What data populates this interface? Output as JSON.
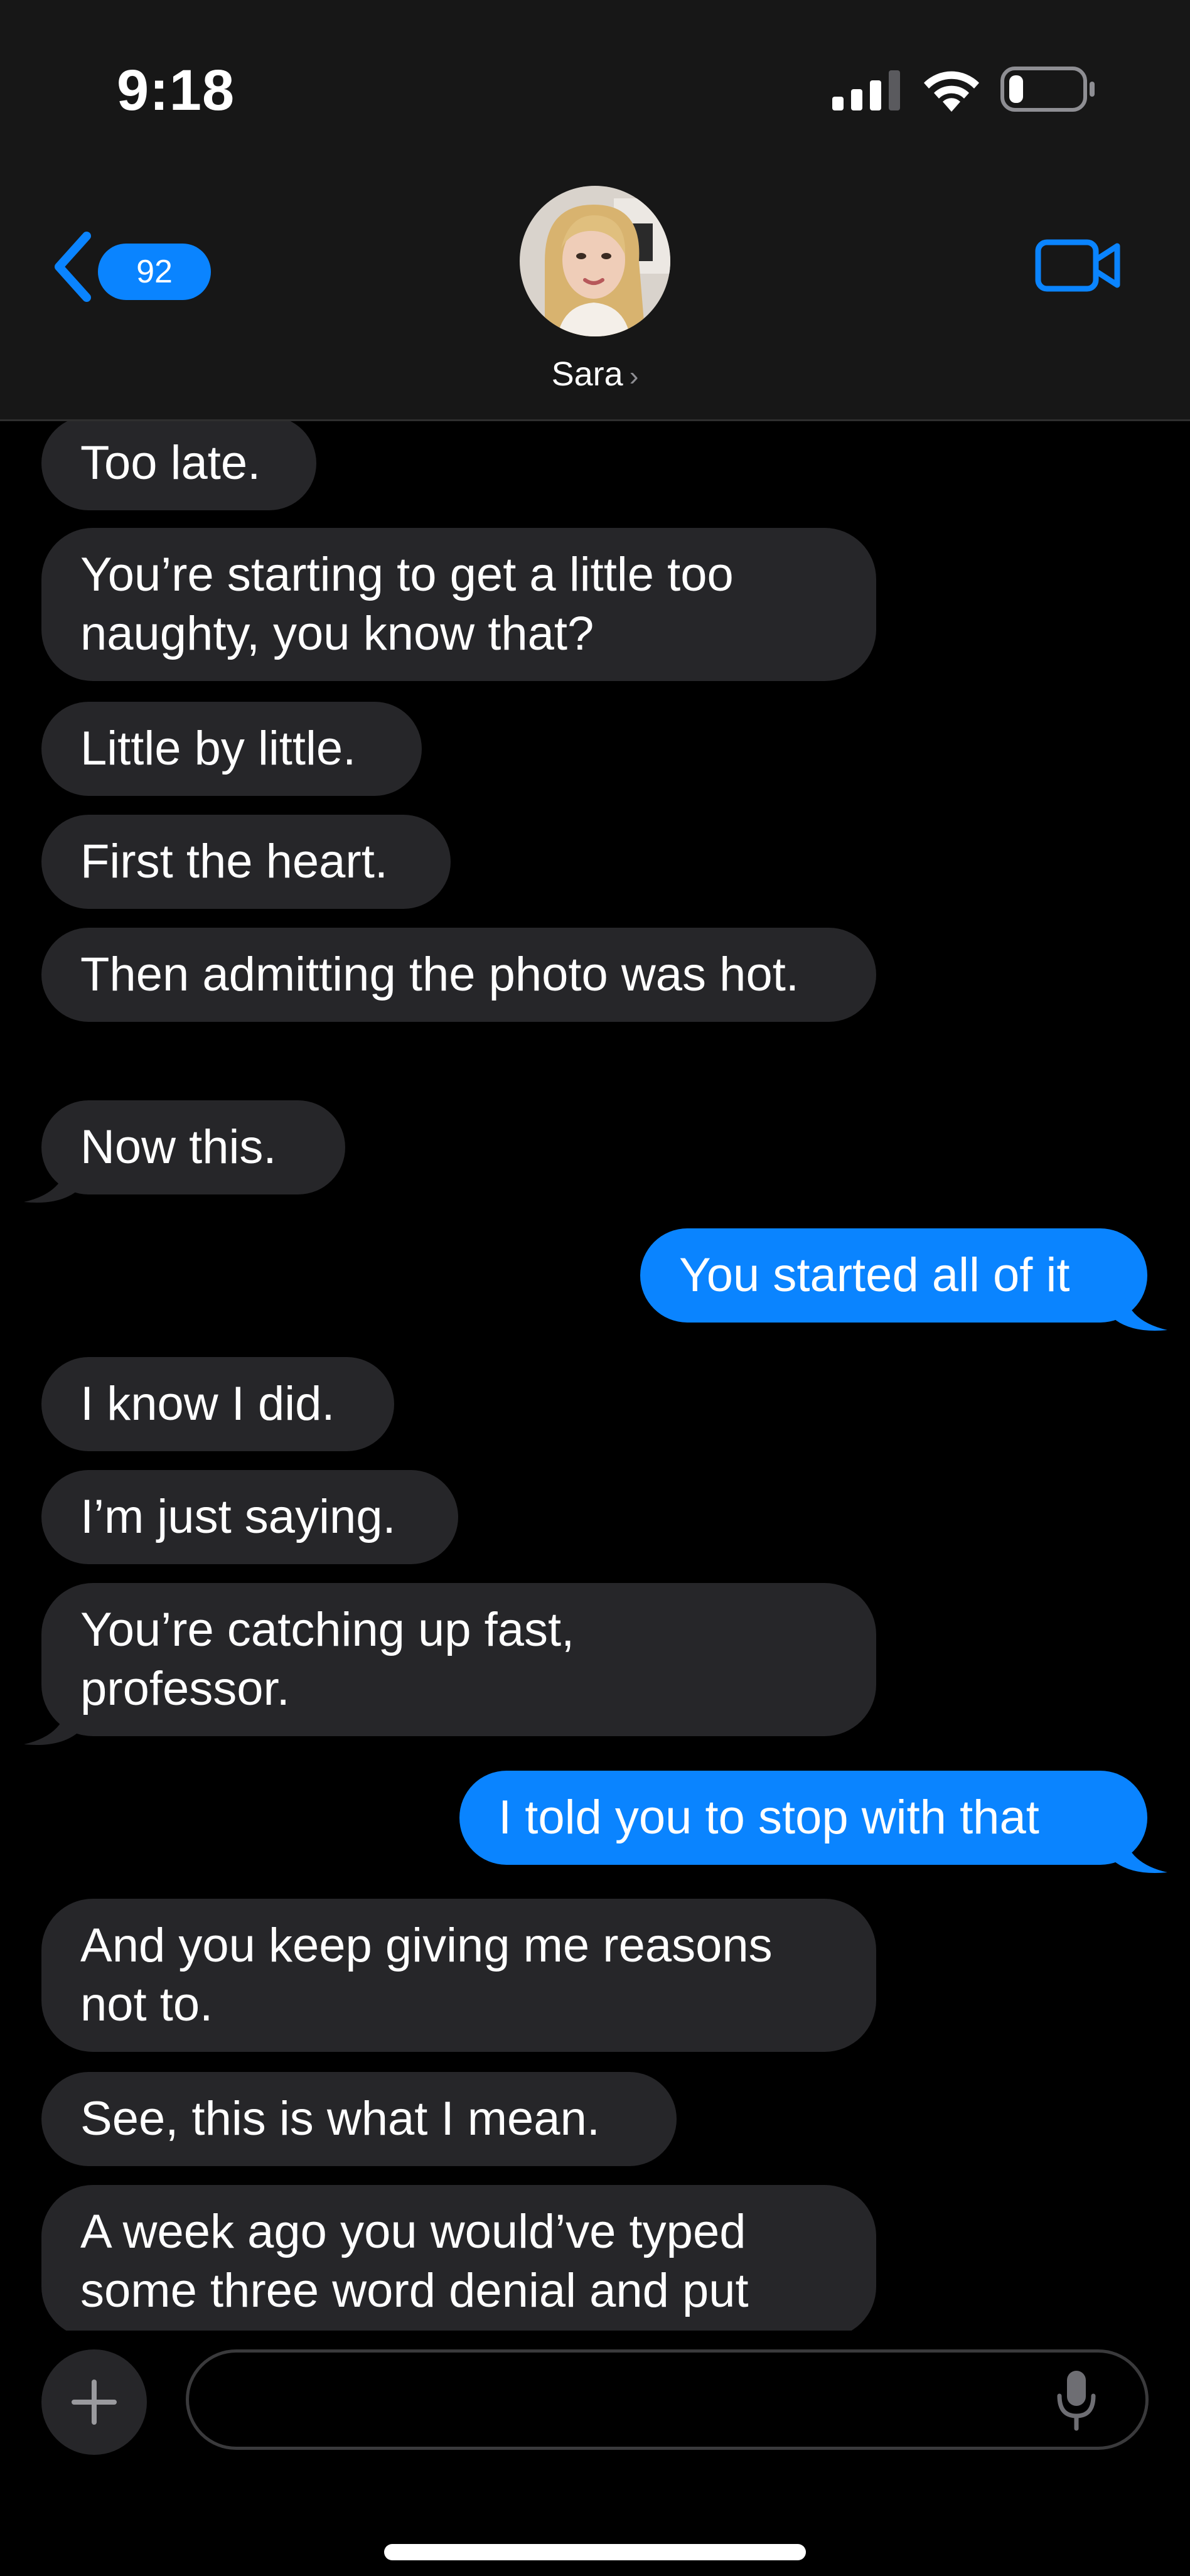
{
  "status_bar": {
    "time": "9:18",
    "battery_level": 0.2,
    "icons": [
      "cellular-signal-icon",
      "wifi-icon",
      "battery-icon"
    ]
  },
  "header": {
    "unread_count": "92",
    "contact_name": "Sara",
    "contact_chevron": "›",
    "icons": [
      "chevron-left-icon",
      "video-camera-icon"
    ]
  },
  "messages": [
    {
      "direction": "incoming",
      "text": "Too late."
    },
    {
      "direction": "incoming",
      "text": "You’re starting to get a little too naughty, you know that?"
    },
    {
      "direction": "incoming",
      "text": "Little by little."
    },
    {
      "direction": "incoming",
      "text": "First the heart."
    },
    {
      "direction": "incoming",
      "text": "Then admitting the photo was hot."
    },
    {
      "direction": "incoming",
      "text": "Now this."
    },
    {
      "direction": "outgoing",
      "text": "You started all of it"
    },
    {
      "direction": "incoming",
      "text": "I know I did."
    },
    {
      "direction": "incoming",
      "text": "I’m just saying."
    },
    {
      "direction": "incoming",
      "text": "You’re catching up fast, professor."
    },
    {
      "direction": "outgoing",
      "text": "I told you to stop with that"
    },
    {
      "direction": "incoming",
      "text": "And you keep giving me reasons not to."
    },
    {
      "direction": "incoming",
      "text": "See, this is what I mean."
    },
    {
      "direction": "incoming",
      "text": "A week ago you would’ve typed some three word denial and put"
    }
  ],
  "compose": {
    "input_value": "",
    "input_placeholder": "",
    "icons": [
      "plus-icon",
      "microphone-icon"
    ]
  },
  "colors": {
    "outgoing_bubble": "#0a84ff",
    "incoming_bubble": "#262629",
    "header_background": "#171717",
    "accent": "#0a84ff"
  }
}
